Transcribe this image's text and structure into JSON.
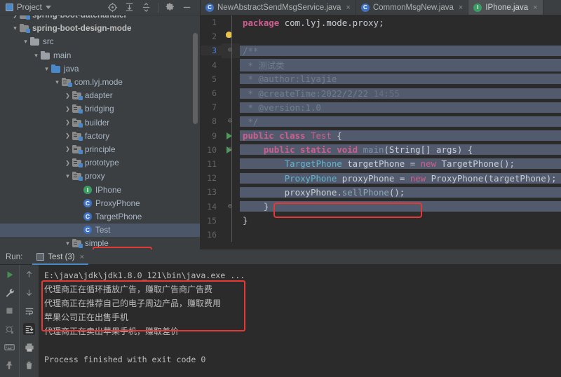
{
  "project_panel": {
    "title": "Project",
    "title_icon": "project-window-icon",
    "dropdown_icon": "chevron-down-icon",
    "toolbar": [
      {
        "name": "locate-target-icon",
        "label": "Select Opened File"
      },
      {
        "name": "expand-all-icon",
        "label": "Expand All"
      },
      {
        "name": "collapse-all-icon",
        "label": "Collapse All"
      },
      {
        "name": "gear-icon",
        "label": "Settings"
      },
      {
        "name": "minimize-icon",
        "label": "Hide"
      }
    ],
    "tree": [
      {
        "label": "spring-boot-datehandler",
        "indent": 1,
        "arrow": "›",
        "icon": "module-folder",
        "kind": "module"
      },
      {
        "label": "spring-boot-design-mode",
        "indent": 1,
        "arrow": "⌄",
        "icon": "module-folder",
        "kind": "module"
      },
      {
        "label": "src",
        "indent": 2,
        "arrow": "⌄",
        "icon": "source-folder",
        "kind": "folder"
      },
      {
        "label": "main",
        "indent": 3,
        "arrow": "⌄",
        "icon": "source-folder",
        "kind": "folder"
      },
      {
        "label": "java",
        "indent": 4,
        "arrow": "⌄",
        "icon": "source-root-folder",
        "kind": "folder"
      },
      {
        "label": "com.lyj.mode",
        "indent": 5,
        "arrow": "⌄",
        "icon": "package-folder",
        "kind": "package"
      },
      {
        "label": "adapter",
        "indent": 6,
        "arrow": "›",
        "icon": "package-folder",
        "kind": "package"
      },
      {
        "label": "bridging",
        "indent": 6,
        "arrow": "›",
        "icon": "package-folder",
        "kind": "package"
      },
      {
        "label": "builder",
        "indent": 6,
        "arrow": "›",
        "icon": "package-folder",
        "kind": "package"
      },
      {
        "label": "factory",
        "indent": 6,
        "arrow": "›",
        "icon": "package-folder",
        "kind": "package"
      },
      {
        "label": "principle",
        "indent": 6,
        "arrow": "›",
        "icon": "package-folder",
        "kind": "package"
      },
      {
        "label": "prototype",
        "indent": 6,
        "arrow": "›",
        "icon": "package-folder",
        "kind": "package"
      },
      {
        "label": "proxy",
        "indent": 6,
        "arrow": "⌄",
        "icon": "package-folder",
        "kind": "package"
      },
      {
        "label": "IPhone",
        "indent": 7,
        "arrow": "",
        "icon": "interface-icon",
        "kind": "interface"
      },
      {
        "label": "ProxyPhone",
        "indent": 7,
        "arrow": "",
        "icon": "class-icon",
        "kind": "class"
      },
      {
        "label": "TargetPhone",
        "indent": 7,
        "arrow": "",
        "icon": "class-icon",
        "kind": "class"
      },
      {
        "label": "Test",
        "indent": 7,
        "arrow": "",
        "icon": "class-icon",
        "kind": "class",
        "selected": true
      },
      {
        "label": "simple",
        "indent": 6,
        "arrow": "⌄",
        "icon": "package-folder",
        "kind": "package",
        "cut": true
      }
    ],
    "selected_highlight_color": "#e53935"
  },
  "editor": {
    "tabs": [
      {
        "label": "NewAbstractSendMsgService.java",
        "icon": "class-icon",
        "active": false,
        "close": "×"
      },
      {
        "label": "CommonMsgNew.java",
        "icon": "class-icon",
        "active": false,
        "close": "×"
      },
      {
        "label": "IPhone.java",
        "icon": "interface-icon",
        "active": true,
        "close": "×"
      }
    ],
    "line_numbers": [
      "1",
      "2",
      "3",
      "4",
      "5",
      "6",
      "7",
      "8",
      "9",
      "10",
      "11",
      "12",
      "13",
      "14",
      "15",
      "16"
    ],
    "current_line": 3,
    "lines": [
      {
        "n": 1,
        "tokens": [
          {
            "t": "package ",
            "c": "kw2"
          },
          {
            "t": "com.lyj.mode.proxy;",
            "c": "plain"
          }
        ]
      },
      {
        "n": 2,
        "tokens": [],
        "bulb": true
      },
      {
        "n": 3,
        "tokens": [
          {
            "t": "/**",
            "c": "cmt"
          }
        ],
        "sel": true,
        "fold": "start"
      },
      {
        "n": 4,
        "tokens": [
          {
            "t": " * 测试类",
            "c": "cmt"
          }
        ],
        "sel": true
      },
      {
        "n": 5,
        "tokens": [
          {
            "t": " * @author:liyajie",
            "c": "cmt"
          }
        ],
        "sel": true
      },
      {
        "n": 6,
        "tokens": [
          {
            "t": " * @createTime:2022/2/22 ",
            "c": "cmt"
          },
          {
            "t": "14:55",
            "c": "cmt-dim"
          }
        ],
        "sel": true
      },
      {
        "n": 7,
        "tokens": [
          {
            "t": " * @version:1.0",
            "c": "cmt"
          }
        ],
        "sel": true
      },
      {
        "n": 8,
        "tokens": [
          {
            "t": " */",
            "c": "cmt"
          }
        ],
        "sel": true,
        "fold": "end"
      },
      {
        "n": 9,
        "tokens": [
          {
            "t": "public class ",
            "c": "kw2"
          },
          {
            "t": "Test ",
            "c": "pink"
          },
          {
            "t": "{",
            "c": "plain"
          }
        ],
        "sel": true,
        "run": true
      },
      {
        "n": 10,
        "tokens": [
          {
            "t": "    public static void ",
            "c": "kw2"
          },
          {
            "t": "main",
            "c": "mth"
          },
          {
            "t": "(String[] args) {",
            "c": "plain"
          }
        ],
        "sel": true,
        "run": true,
        "fold": "start"
      },
      {
        "n": 11,
        "tokens": [
          {
            "t": "        ",
            "c": "plain"
          },
          {
            "t": "TargetPhone",
            "c": "cls-t"
          },
          {
            "t": " targetPhone = ",
            "c": "plain"
          },
          {
            "t": "new ",
            "c": "pink"
          },
          {
            "t": "TargetPhone();",
            "c": "plain"
          }
        ],
        "sel": true
      },
      {
        "n": 12,
        "tokens": [
          {
            "t": "        ",
            "c": "plain"
          },
          {
            "t": "ProxyPhone",
            "c": "cls-t"
          },
          {
            "t": " proxyPhone = ",
            "c": "plain"
          },
          {
            "t": "new ",
            "c": "pink"
          },
          {
            "t": "ProxyPhone(targetPhone);",
            "c": "plain"
          }
        ],
        "sel": true
      },
      {
        "n": 13,
        "tokens": [
          {
            "t": "        proxyPhone.",
            "c": "plain"
          },
          {
            "t": "sellPhone",
            "c": "mthd"
          },
          {
            "t": "();",
            "c": "plain"
          }
        ],
        "sel": true,
        "boxed": true
      },
      {
        "n": 14,
        "tokens": [
          {
            "t": "    }",
            "c": "plain"
          }
        ],
        "sel": true,
        "fold": "end"
      },
      {
        "n": 15,
        "tokens": [
          {
            "t": "}",
            "c": "plain"
          }
        ]
      },
      {
        "n": 16,
        "tokens": []
      }
    ],
    "highlight_box_color": "#e53935"
  },
  "run_panel": {
    "run_label": "Run:",
    "tab_label": "Test (3)",
    "tab_icon": "run-configuration-icon",
    "tab_close": "×",
    "left_toolbar": [
      {
        "name": "rerun-icon",
        "label": "Rerun"
      },
      {
        "name": "wrench-icon",
        "label": "Edit Configuration"
      },
      {
        "name": "stop-icon",
        "label": "Stop"
      },
      {
        "name": "stop-debug-icon",
        "label": "Stop Background"
      },
      {
        "name": "keyboard-icon",
        "label": "Console Input"
      },
      {
        "name": "pin-icon",
        "label": "Pin Tab"
      }
    ],
    "second_toolbar": [
      {
        "name": "arrow-up-icon",
        "label": "Up the Stack Trace"
      },
      {
        "name": "arrow-down-icon",
        "label": "Down the Stack Trace"
      },
      {
        "name": "soft-wrap-icon",
        "label": "Soft-Wrap"
      },
      {
        "name": "scroll-to-end-icon",
        "label": "Scroll to End",
        "active": true
      },
      {
        "name": "print-icon",
        "label": "Print"
      },
      {
        "name": "trash-icon",
        "label": "Clear All"
      }
    ],
    "console_lines": [
      {
        "text": "E:\\java\\jdk\\jdk1.8.0_121\\bin\\java.exe ...",
        "kind": "command"
      },
      {
        "text": "代理商正在循环播放广告，赚取广告商广告费",
        "kind": "out"
      },
      {
        "text": "代理商正在推荐自己的电子周边产品，赚取费用",
        "kind": "out"
      },
      {
        "text": "苹果公司正在出售手机",
        "kind": "out"
      },
      {
        "text": "代理商正在卖出苹果手机，赚取差价",
        "kind": "out"
      },
      {
        "text": "",
        "kind": "blank"
      },
      {
        "text": "Process finished with exit code 0",
        "kind": "status"
      }
    ],
    "highlight_box_color": "#e53935"
  }
}
